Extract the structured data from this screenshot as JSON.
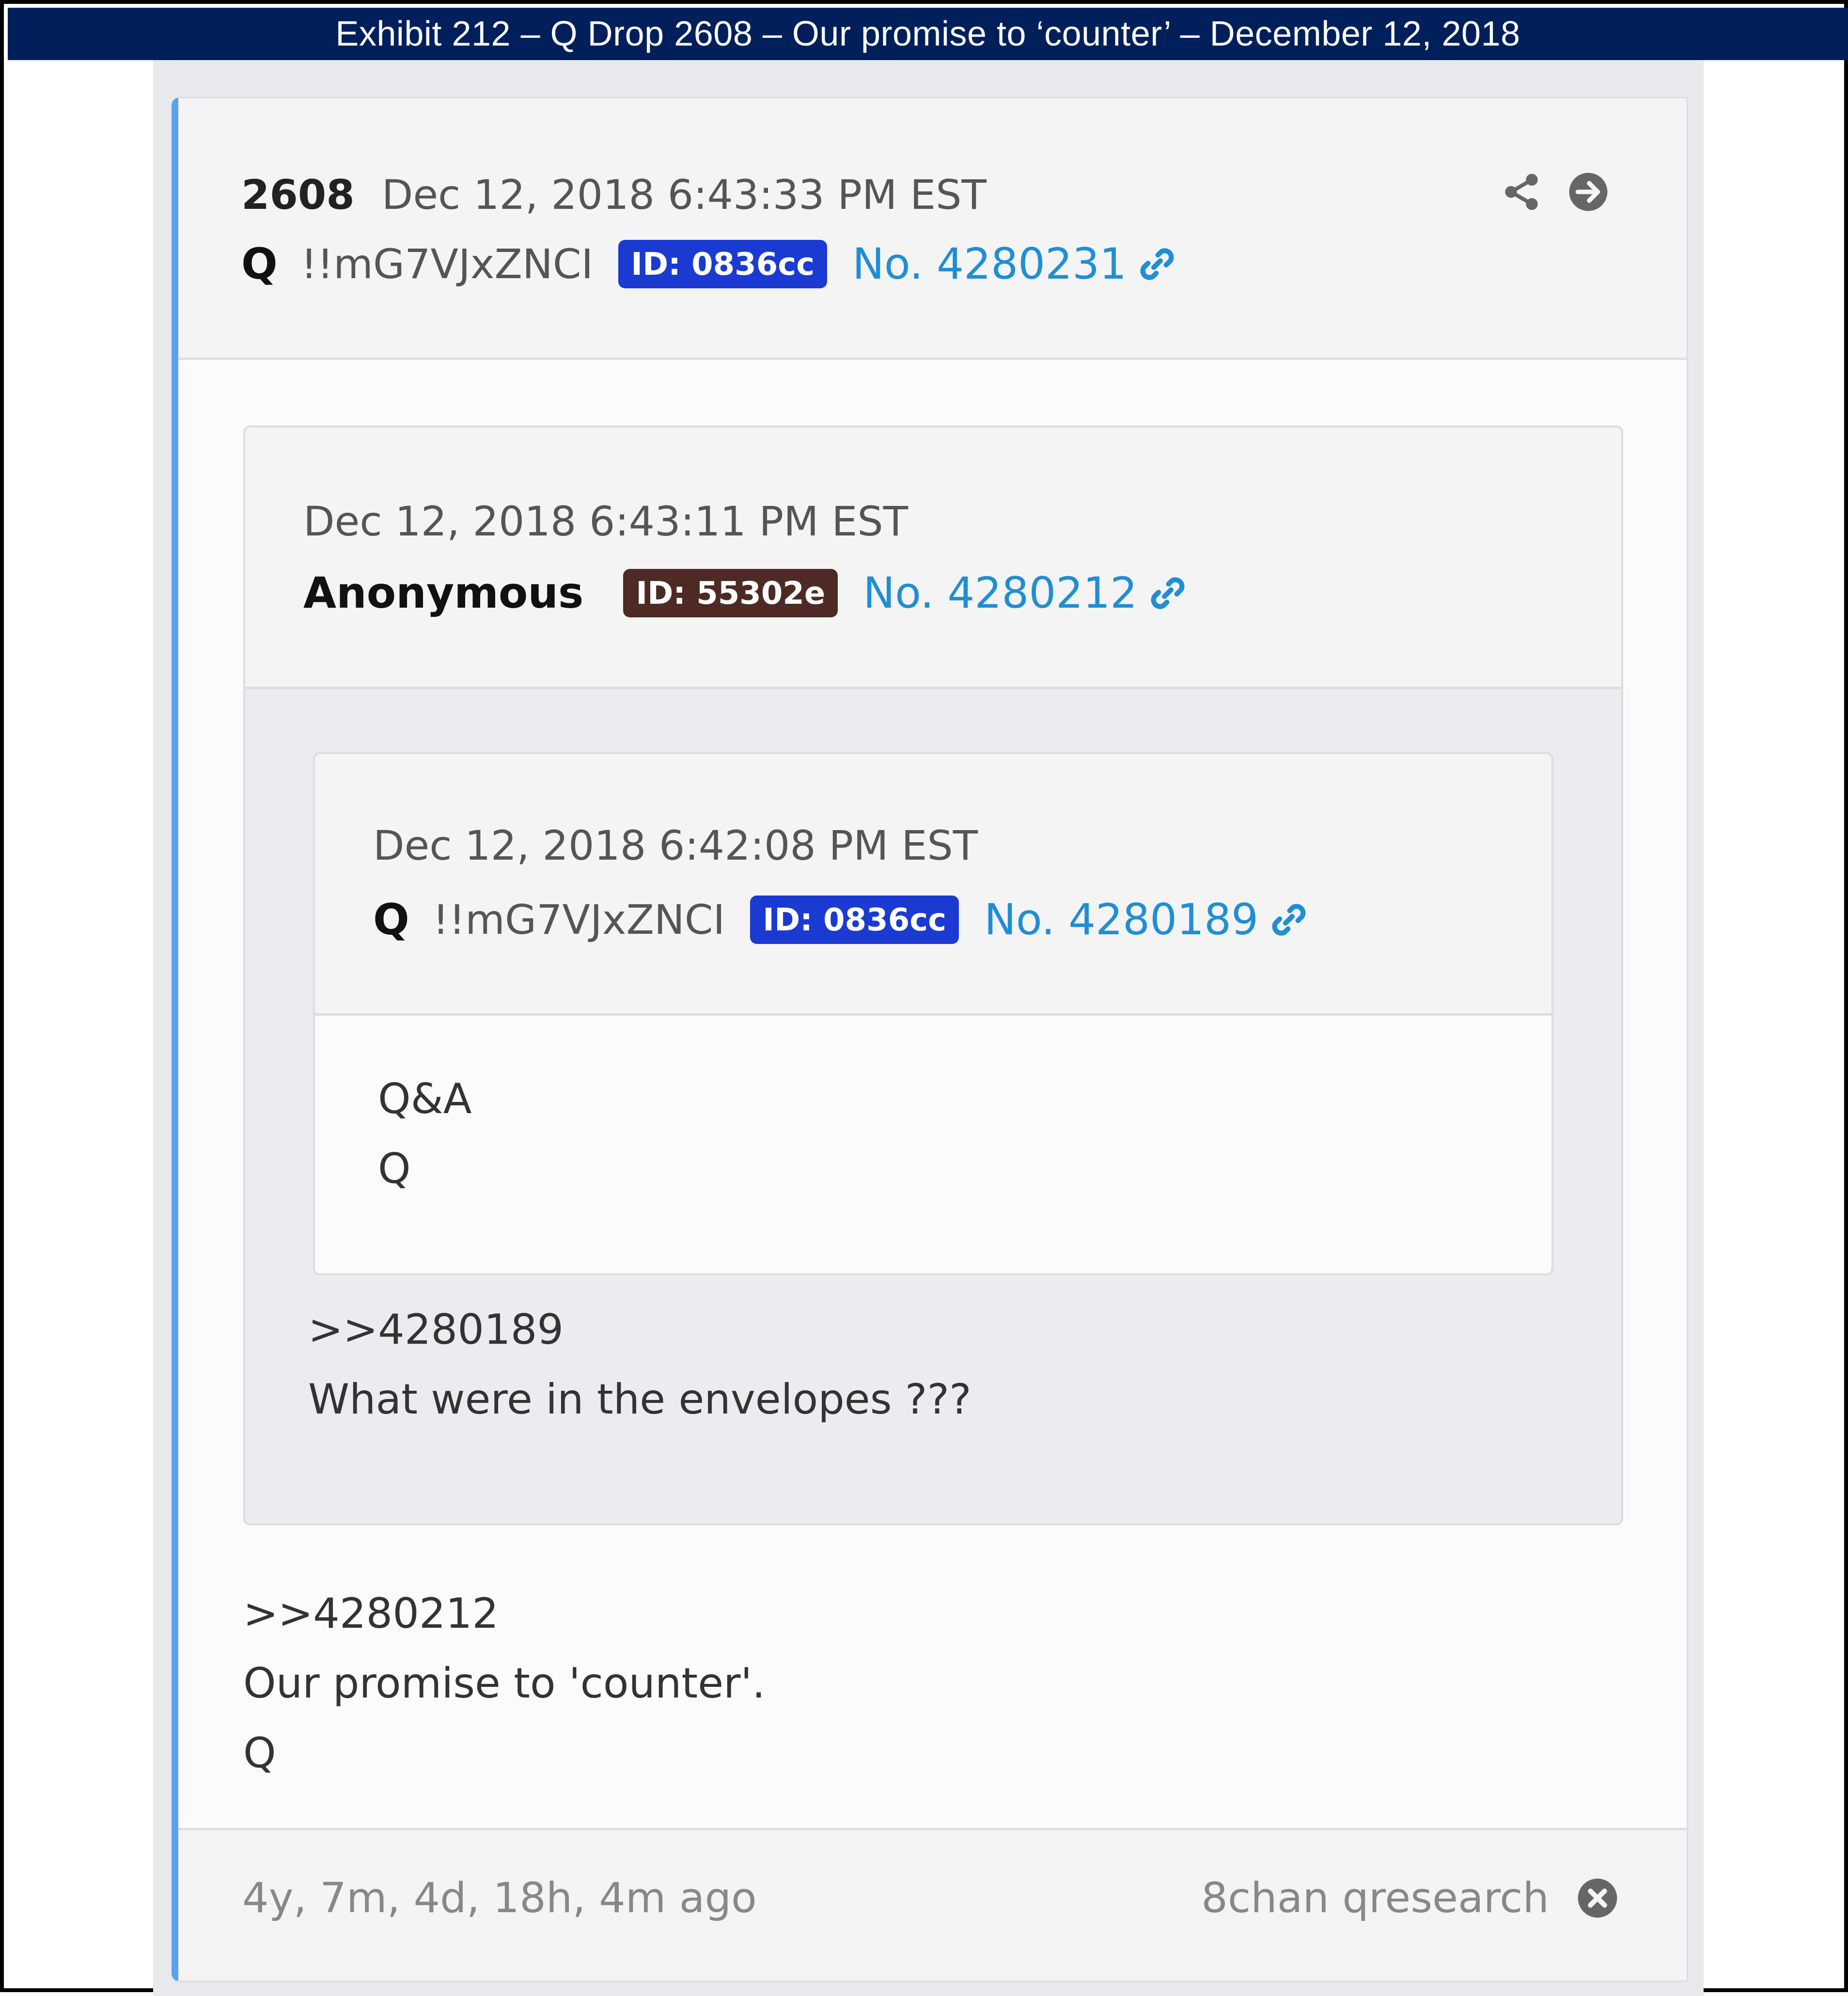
{
  "banner": {
    "title": "Exhibit 212 – Q Drop 2608 – Our promise to ‘counter’ – December 12, 2018"
  },
  "post": {
    "number": "2608",
    "timestamp": "Dec 12, 2018 6:43:33 PM EST",
    "author": "Q",
    "tripcode": "!!mG7VJxZNCI",
    "id_badge": "ID: 0836cc",
    "post_no": "No. 4280231",
    "icons": [
      "share-icon",
      "arrow-circle-right-icon",
      "link-icon"
    ],
    "body_lines": [
      ">>4280212",
      "Our promise to 'counter'.",
      "Q"
    ]
  },
  "quote1": {
    "timestamp": "Dec 12, 2018 6:43:11 PM EST",
    "author": "Anonymous",
    "id_badge": "ID: 55302e",
    "post_no": "No. 4280212",
    "body_lines": [
      ">>4280189",
      "What were in the envelopes ???"
    ]
  },
  "quote2": {
    "timestamp": "Dec 12, 2018 6:42:08 PM EST",
    "author": "Q",
    "tripcode": "!!mG7VJxZNCI",
    "id_badge": "ID: 0836cc",
    "post_no": "No. 4280189",
    "body_lines": [
      "Q&A",
      "Q"
    ]
  },
  "footer": {
    "elapsed": "4y, 7m, 4d, 18h, 4m ago",
    "source": "8chan qresearch",
    "icons": [
      "close-circle-icon"
    ]
  },
  "colors": {
    "banner_bg": "#001f5b",
    "accent_blue": "#5aa2f0",
    "link_blue": "#1f8ed4",
    "badge_blue": "#1a3ad1",
    "badge_brown": "#4e2a24"
  }
}
